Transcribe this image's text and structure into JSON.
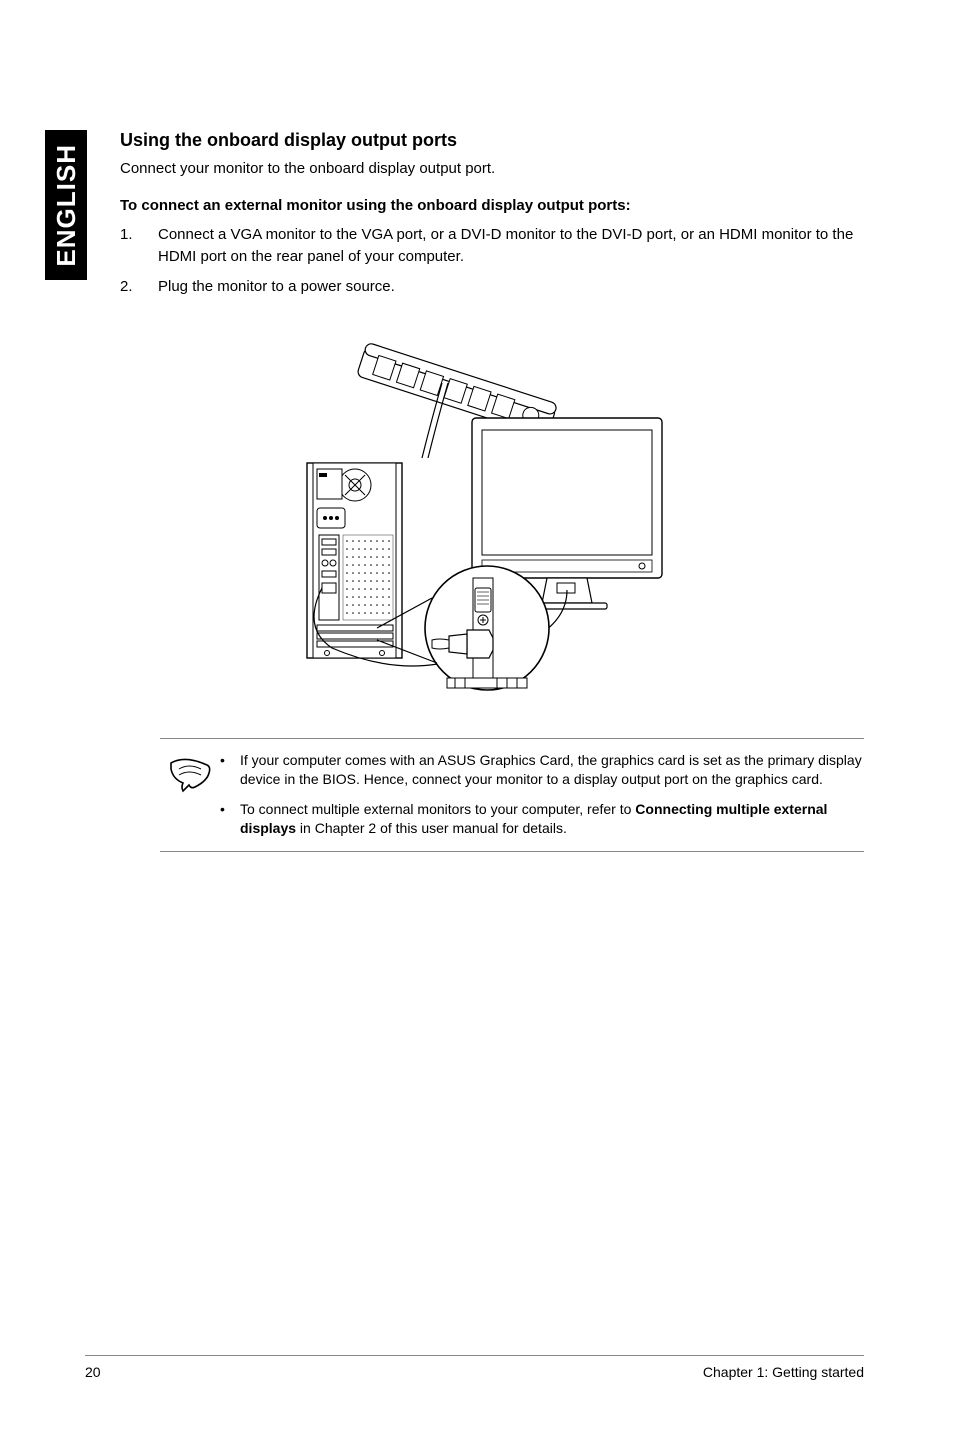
{
  "sideTab": "ENGLISH",
  "heading": "Using the onboard display output ports",
  "intro": "Connect your monitor to the onboard display output port.",
  "subheading": "To connect an external monitor using the onboard display output ports:",
  "steps": [
    {
      "num": "1.",
      "text": "Connect a VGA monitor to the VGA port, or a DVI-D monitor to the DVI-D port, or an HDMI monitor to the HDMI port on the rear panel of your computer."
    },
    {
      "num": "2.",
      "text": "Plug the monitor to a power source."
    }
  ],
  "notes": [
    {
      "pre": "If your computer comes with an ASUS Graphics Card, the graphics card is set as the primary display device in the BIOS. Hence, connect your monitor to a display output port on the graphics card."
    },
    {
      "pre": "To connect multiple external monitors to your computer, refer to ",
      "bold": "Connecting multiple external displays",
      "post": " in Chapter 2 of this user manual for details."
    }
  ],
  "footer": {
    "pageNum": "20",
    "chapter": "Chapter 1: Getting started"
  }
}
